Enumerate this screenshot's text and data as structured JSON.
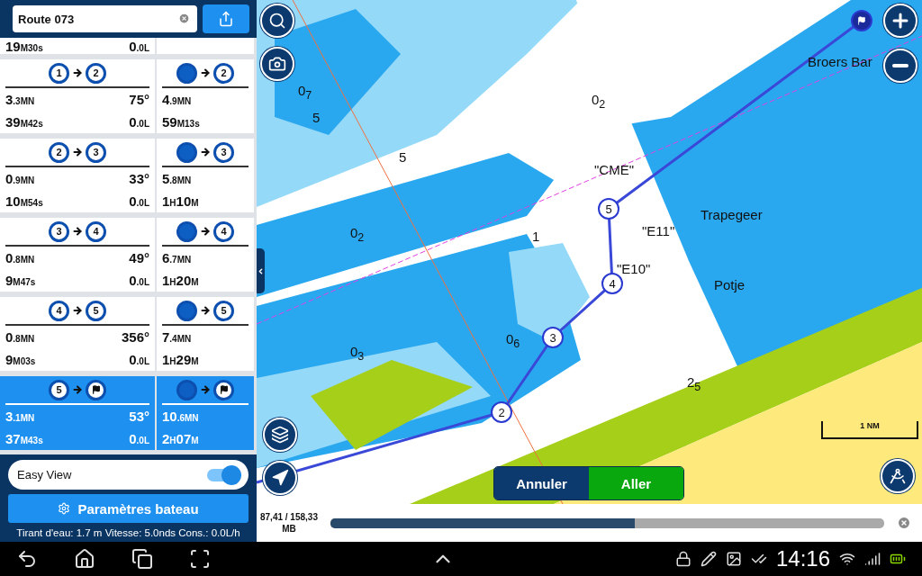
{
  "route": {
    "name": "Route 073"
  },
  "partial_leg": {
    "time": [
      {
        "t": "19",
        "small": false
      },
      {
        "t": "M30s",
        "small": true
      }
    ],
    "fuel": [
      {
        "t": "0",
        "small": false
      },
      {
        "t": ".0L",
        "small": true
      }
    ]
  },
  "legs": [
    {
      "selected": false,
      "from": {
        "kind": "number",
        "label": "1"
      },
      "to": {
        "kind": "number",
        "label": "2"
      },
      "total_to": {
        "kind": "number",
        "label": "2"
      },
      "distance": [
        {
          "t": "3",
          "small": false
        },
        {
          "t": ".3MN",
          "small": true
        }
      ],
      "bearing": "75°",
      "time": [
        {
          "t": "39",
          "small": false
        },
        {
          "t": "M42s",
          "small": true
        }
      ],
      "fuel": [
        {
          "t": "0",
          "small": false
        },
        {
          "t": ".0L",
          "small": true
        }
      ],
      "total_from": {
        "kind": "position"
      },
      "total_distance": [
        {
          "t": "4",
          "small": false
        },
        {
          "t": ".9MN",
          "small": true
        }
      ],
      "total_time": [
        {
          "t": "59",
          "small": false
        },
        {
          "t": "M13s",
          "small": true
        }
      ]
    },
    {
      "selected": false,
      "from": {
        "kind": "number",
        "label": "2"
      },
      "to": {
        "kind": "number",
        "label": "3"
      },
      "total_to": {
        "kind": "number",
        "label": "3"
      },
      "distance": [
        {
          "t": "0",
          "small": false
        },
        {
          "t": ".9MN",
          "small": true
        }
      ],
      "bearing": "33°",
      "time": [
        {
          "t": "10",
          "small": false
        },
        {
          "t": "M54s",
          "small": true
        }
      ],
      "fuel": [
        {
          "t": "0",
          "small": false
        },
        {
          "t": ".0L",
          "small": true
        }
      ],
      "total_from": {
        "kind": "position"
      },
      "total_distance": [
        {
          "t": "5",
          "small": false
        },
        {
          "t": ".8MN",
          "small": true
        }
      ],
      "total_time": [
        {
          "t": "1",
          "small": false
        },
        {
          "t": "H",
          "small": true
        },
        {
          "t": "10",
          "small": false
        },
        {
          "t": "M",
          "small": true
        }
      ]
    },
    {
      "selected": false,
      "from": {
        "kind": "number",
        "label": "3"
      },
      "to": {
        "kind": "number",
        "label": "4"
      },
      "total_to": {
        "kind": "number",
        "label": "4"
      },
      "distance": [
        {
          "t": "0",
          "small": false
        },
        {
          "t": ".8MN",
          "small": true
        }
      ],
      "bearing": "49°",
      "time": [
        {
          "t": "9",
          "small": false
        },
        {
          "t": "M47s",
          "small": true
        }
      ],
      "fuel": [
        {
          "t": "0",
          "small": false
        },
        {
          "t": ".0L",
          "small": true
        }
      ],
      "total_from": {
        "kind": "position"
      },
      "total_distance": [
        {
          "t": "6",
          "small": false
        },
        {
          "t": ".7MN",
          "small": true
        }
      ],
      "total_time": [
        {
          "t": "1",
          "small": false
        },
        {
          "t": "H",
          "small": true
        },
        {
          "t": "20",
          "small": false
        },
        {
          "t": "M",
          "small": true
        }
      ]
    },
    {
      "selected": false,
      "from": {
        "kind": "number",
        "label": "4"
      },
      "to": {
        "kind": "number",
        "label": "5"
      },
      "total_to": {
        "kind": "number",
        "label": "5"
      },
      "distance": [
        {
          "t": "0",
          "small": false
        },
        {
          "t": ".8MN",
          "small": true
        }
      ],
      "bearing": "356°",
      "time": [
        {
          "t": "9",
          "small": false
        },
        {
          "t": "M03s",
          "small": true
        }
      ],
      "fuel": [
        {
          "t": "0",
          "small": false
        },
        {
          "t": ".0L",
          "small": true
        }
      ],
      "total_from": {
        "kind": "position"
      },
      "total_distance": [
        {
          "t": "7",
          "small": false
        },
        {
          "t": ".4MN",
          "small": true
        }
      ],
      "total_time": [
        {
          "t": "1",
          "small": false
        },
        {
          "t": "H",
          "small": true
        },
        {
          "t": "29",
          "small": false
        },
        {
          "t": "M",
          "small": true
        }
      ]
    },
    {
      "selected": true,
      "from": {
        "kind": "number",
        "label": "5"
      },
      "to": {
        "kind": "finish"
      },
      "total_to": {
        "kind": "finish"
      },
      "distance": [
        {
          "t": "3",
          "small": false
        },
        {
          "t": ".1MN",
          "small": true
        }
      ],
      "bearing": "53°",
      "time": [
        {
          "t": "37",
          "small": false
        },
        {
          "t": "M43s",
          "small": true
        }
      ],
      "fuel": [
        {
          "t": "0",
          "small": false
        },
        {
          "t": ".0L",
          "small": true
        }
      ],
      "total_from": {
        "kind": "position"
      },
      "total_distance": [
        {
          "t": "10",
          "small": false
        },
        {
          "t": ".6MN",
          "small": true
        }
      ],
      "total_time": [
        {
          "t": "2",
          "small": false
        },
        {
          "t": "H",
          "small": true
        },
        {
          "t": "07",
          "small": false
        },
        {
          "t": "M",
          "small": true
        }
      ]
    }
  ],
  "easy_view": {
    "label": "Easy View",
    "on": true
  },
  "settings_button": "Paramètres bateau",
  "boat_status": "Tirant d'eau: 1.7 m Vitesse: 5.0nds Cons.: 0.0L/h",
  "map": {
    "labels": [
      "Trapegeer",
      "Potje",
      "Broers Bar",
      "\"CME\"",
      "\"E11\"",
      "\"E10\""
    ],
    "soundings": [
      "0$_{7}$",
      "5",
      "5",
      "0$_{2}$",
      "1",
      "0$_{3}$",
      "0$_{6}$",
      "0$_{2}$",
      "2$_{5}$"
    ],
    "waypoints": [
      {
        "kind": "number",
        "label": "2"
      },
      {
        "kind": "number",
        "label": "3"
      },
      {
        "kind": "number",
        "label": "4"
      },
      {
        "kind": "number",
        "label": "5"
      },
      {
        "kind": "finish"
      }
    ],
    "scale": "1 NM",
    "actions": [
      {
        "label": "Annuler",
        "kind": "cancel"
      },
      {
        "label": "Aller",
        "kind": "go"
      }
    ]
  },
  "download": {
    "amount": "87,41 / 158,33",
    "unit": "MB",
    "level": 0.55
  },
  "status_bar": {
    "time": "14:16"
  }
}
